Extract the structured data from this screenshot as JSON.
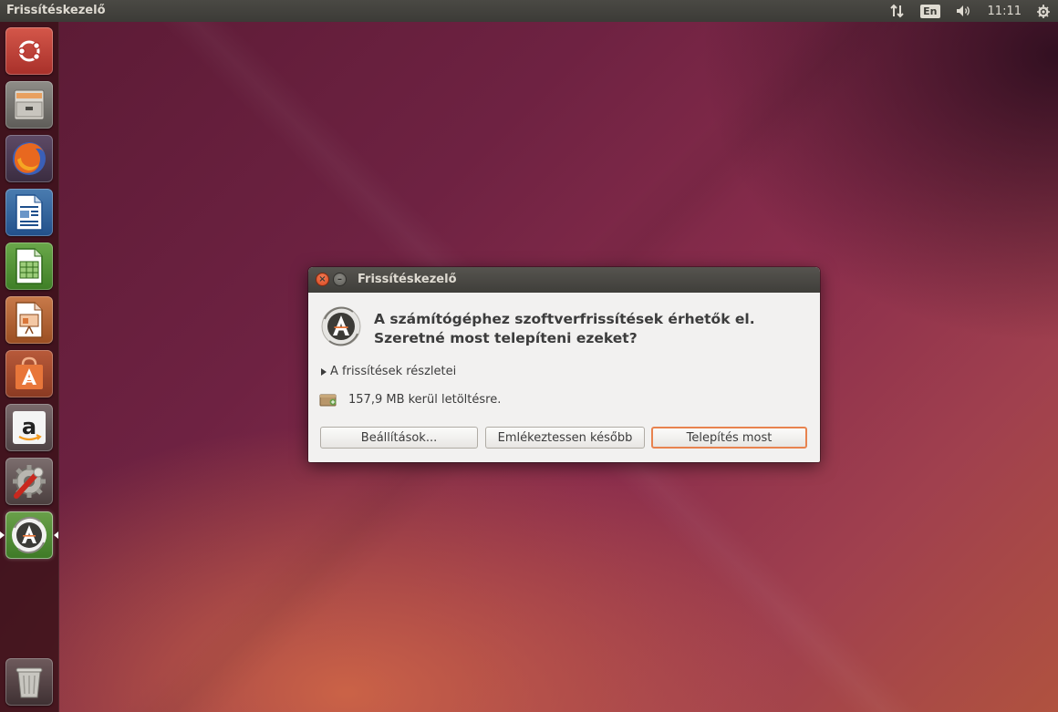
{
  "top_panel": {
    "app_title": "Frissítéskezelő",
    "keyboard_layout": "En",
    "clock": "11:11"
  },
  "launcher": {
    "items": [
      {
        "name": "Dash",
        "icon": "ubuntu-logo-icon"
      },
      {
        "name": "Files",
        "icon": "file-cabinet-icon"
      },
      {
        "name": "Firefox",
        "icon": "firefox-icon"
      },
      {
        "name": "LibreOffice Writer",
        "icon": "writer-icon"
      },
      {
        "name": "LibreOffice Calc",
        "icon": "calc-icon"
      },
      {
        "name": "LibreOffice Impress",
        "icon": "impress-icon"
      },
      {
        "name": "Ubuntu Software Center",
        "icon": "software-center-icon"
      },
      {
        "name": "Amazon",
        "icon": "amazon-icon"
      },
      {
        "name": "System Settings",
        "icon": "settings-wrench-icon"
      },
      {
        "name": "Software Updater",
        "icon": "software-updater-icon"
      },
      {
        "name": "Trash",
        "icon": "trash-icon"
      }
    ]
  },
  "dialog": {
    "title": "Frissítéskezelő",
    "headline_line1": "A számítógéphez szoftverfrissítések érhetők el.",
    "headline_line2": "Szeretné most telepíteni ezeket?",
    "details_expander": "A frissítések részletei",
    "download_size": "157,9 MB kerül letöltésre.",
    "buttons": {
      "settings": "Beállítások...",
      "remind_later": "Emlékeztessen később",
      "install_now": "Telepítés most"
    }
  },
  "colors": {
    "accent_orange": "#e8834f",
    "panel_bg": "#3c3b37",
    "dialog_bg": "#f2f1f0"
  }
}
